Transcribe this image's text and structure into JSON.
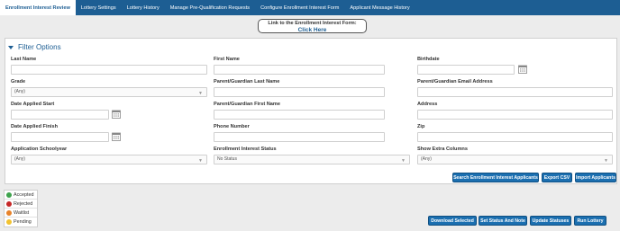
{
  "nav": {
    "tabs": [
      {
        "label": "Enrollment Interest Review",
        "active": true
      },
      {
        "label": "Lottery Settings"
      },
      {
        "label": "Lottery History"
      },
      {
        "label": "Manage Pre-Qualification Requests"
      },
      {
        "label": "Configure Enrollment Interest Form"
      },
      {
        "label": "Applicant Message History"
      }
    ]
  },
  "link_box": {
    "text": "Link to the Enrollment Interest Form:",
    "cta": "Click Here"
  },
  "filter": {
    "title": "Filter Options",
    "last_name": "Last Name",
    "first_name": "First Name",
    "birthdate": "Birthdate",
    "grade": "Grade",
    "grade_value": "(Any)",
    "guardian_last": "Parent/Guardian Last Name",
    "guardian_email": "Parent/Guardian Email Address",
    "date_start": "Date Applied Start",
    "guardian_first": "Parent/Guardian First Name",
    "address": "Address",
    "date_finish": "Date Applied Finish",
    "phone": "Phone Number",
    "zip": "Zip",
    "schoolyear": "Application Schoolyear",
    "schoolyear_value": "(Any)",
    "status": "Enrollment Interest Status",
    "status_value": "No Status",
    "extra_cols": "Show Extra Columns",
    "extra_cols_value": "(Any)"
  },
  "actions": {
    "search": "Search Enrollment Interest Applicants",
    "export": "Export CSV",
    "import": "Import Applicants",
    "download": "Download Selected",
    "set_status": "Set Status And Note",
    "update": "Update Statuses",
    "run": "Run Lottery"
  },
  "legend": [
    {
      "label": "Accepted",
      "color": "#3fa34d"
    },
    {
      "label": "Rejected",
      "color": "#c62828"
    },
    {
      "label": "Waitlist",
      "color": "#e8832a"
    },
    {
      "label": "Pending",
      "color": "#f2c230"
    }
  ],
  "colors": {
    "brand": "#1d5e93",
    "button": "#1b6fb0"
  }
}
